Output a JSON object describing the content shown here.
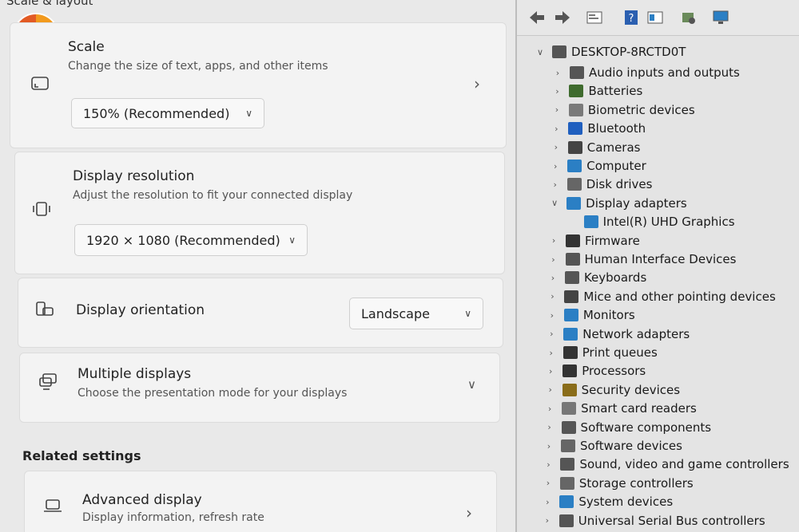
{
  "settings": {
    "section_title": "Scale & layout",
    "scale": {
      "title": "Scale",
      "subtitle": "Change the size of text, apps, and other items",
      "value": "150% (Recommended)"
    },
    "resolution": {
      "title": "Display resolution",
      "subtitle": "Adjust the resolution to fit your connected display",
      "value": "1920 × 1080 (Recommended)"
    },
    "orientation": {
      "title": "Display orientation",
      "value": "Landscape"
    },
    "multiple": {
      "title": "Multiple displays",
      "subtitle": "Choose the presentation mode for your displays"
    },
    "related_title": "Related settings",
    "advanced": {
      "title": "Advanced display",
      "subtitle": "Display information, refresh rate"
    }
  },
  "device_manager": {
    "computer_name": "DESKTOP-8RCTD0T",
    "categories": [
      {
        "label": "Audio inputs and outputs",
        "icon": "speaker-icon",
        "color": "#555555"
      },
      {
        "label": "Batteries",
        "icon": "battery-icon",
        "color": "#3f6b2e"
      },
      {
        "label": "Biometric devices",
        "icon": "fingerprint-icon",
        "color": "#7a7a7a"
      },
      {
        "label": "Bluetooth",
        "icon": "bluetooth-icon",
        "color": "#1f5fbf"
      },
      {
        "label": "Cameras",
        "icon": "camera-icon",
        "color": "#444444"
      },
      {
        "label": "Computer",
        "icon": "computer-icon",
        "color": "#2b7fc4"
      },
      {
        "label": "Disk drives",
        "icon": "disk-icon",
        "color": "#666666"
      },
      {
        "label": "Display adapters",
        "icon": "display-adapter-icon",
        "color": "#2b7fc4"
      },
      {
        "label": "Intel(R) UHD Graphics",
        "icon": "display-adapter-icon",
        "color": "#2b7fc4"
      },
      {
        "label": "Firmware",
        "icon": "firmware-icon",
        "color": "#333333"
      },
      {
        "label": "Human Interface Devices",
        "icon": "hid-icon",
        "color": "#555555"
      },
      {
        "label": "Keyboards",
        "icon": "keyboard-icon",
        "color": "#555555"
      },
      {
        "label": "Mice and other pointing devices",
        "icon": "mouse-icon",
        "color": "#444444"
      },
      {
        "label": "Monitors",
        "icon": "monitor-icon",
        "color": "#2b7fc4"
      },
      {
        "label": "Network adapters",
        "icon": "network-icon",
        "color": "#2b7fc4"
      },
      {
        "label": "Print queues",
        "icon": "printer-icon",
        "color": "#333333"
      },
      {
        "label": "Processors",
        "icon": "processor-icon",
        "color": "#333333"
      },
      {
        "label": "Security devices",
        "icon": "security-icon",
        "color": "#8a6d1a"
      },
      {
        "label": "Smart card readers",
        "icon": "smart-card-icon",
        "color": "#777777"
      },
      {
        "label": "Software components",
        "icon": "software-component-icon",
        "color": "#555555"
      },
      {
        "label": "Software devices",
        "icon": "software-device-icon",
        "color": "#666666"
      },
      {
        "label": "Sound, video and game controllers",
        "icon": "sound-icon",
        "color": "#555555"
      },
      {
        "label": "Storage controllers",
        "icon": "storage-icon",
        "color": "#666666"
      },
      {
        "label": "System devices",
        "icon": "system-icon",
        "color": "#2b7fc4"
      },
      {
        "label": "Universal Serial Bus controllers",
        "icon": "usb-icon",
        "color": "#555555"
      }
    ]
  }
}
